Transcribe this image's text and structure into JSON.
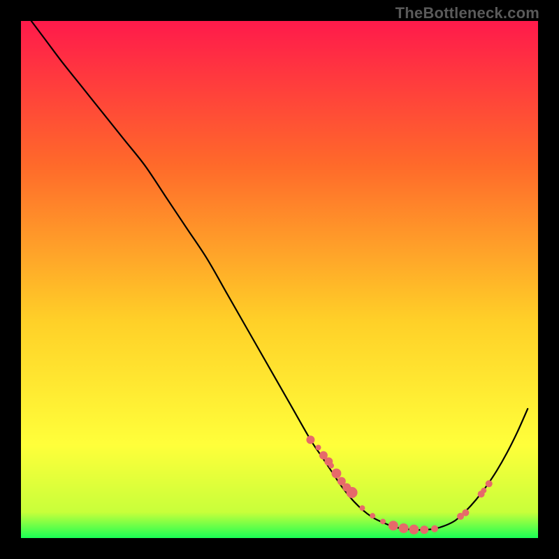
{
  "watermark": "TheBottleneck.com",
  "colors": {
    "gradient_top": "#ff1a4b",
    "gradient_mid1": "#ff6a2a",
    "gradient_mid2": "#ffd028",
    "gradient_mid3": "#ffff3a",
    "gradient_bottom": "#1aff55",
    "curve": "#000000",
    "marker": "#e66a6a",
    "background": "#000000"
  },
  "chart_data": {
    "type": "line",
    "title": "",
    "xlabel": "",
    "ylabel": "",
    "xlim": [
      0,
      100
    ],
    "ylim": [
      0,
      100
    ],
    "series": [
      {
        "name": "curve",
        "x": [
          2,
          5,
          8,
          12,
          16,
          20,
          24,
          28,
          32,
          36,
          40,
          44,
          48,
          52,
          56,
          58,
          60,
          62,
          64,
          66,
          68,
          70,
          72,
          74,
          76,
          78,
          80,
          82,
          84,
          86,
          88,
          90,
          92,
          94,
          96,
          98
        ],
        "y": [
          100,
          96,
          92,
          87,
          82,
          77,
          72,
          66,
          60,
          54,
          47,
          40,
          33,
          26,
          19,
          16,
          13,
          10,
          7.5,
          5.5,
          4,
          3,
          2.2,
          1.8,
          1.6,
          1.6,
          1.8,
          2.4,
          3.4,
          5.2,
          7.4,
          10,
          13,
          16.5,
          20.5,
          25
        ]
      }
    ],
    "markers": {
      "name": "points",
      "x": [
        56,
        57.5,
        58.5,
        59.5,
        60,
        61,
        62,
        63,
        64,
        66,
        68,
        70,
        72,
        74,
        76,
        78,
        80,
        85,
        86,
        89,
        89.5,
        90.5
      ],
      "y": [
        19,
        17.5,
        16,
        14.8,
        14,
        12.5,
        11,
        9.8,
        8.8,
        5.8,
        4.3,
        3.2,
        2.4,
        1.9,
        1.65,
        1.6,
        1.8,
        4.2,
        4.9,
        8.5,
        9.2,
        10.5
      ],
      "r": [
        6,
        4,
        6,
        6,
        4,
        7,
        6,
        6,
        8,
        4,
        4,
        4,
        7,
        7,
        7,
        6,
        5,
        5,
        5,
        5,
        4,
        5
      ]
    }
  }
}
